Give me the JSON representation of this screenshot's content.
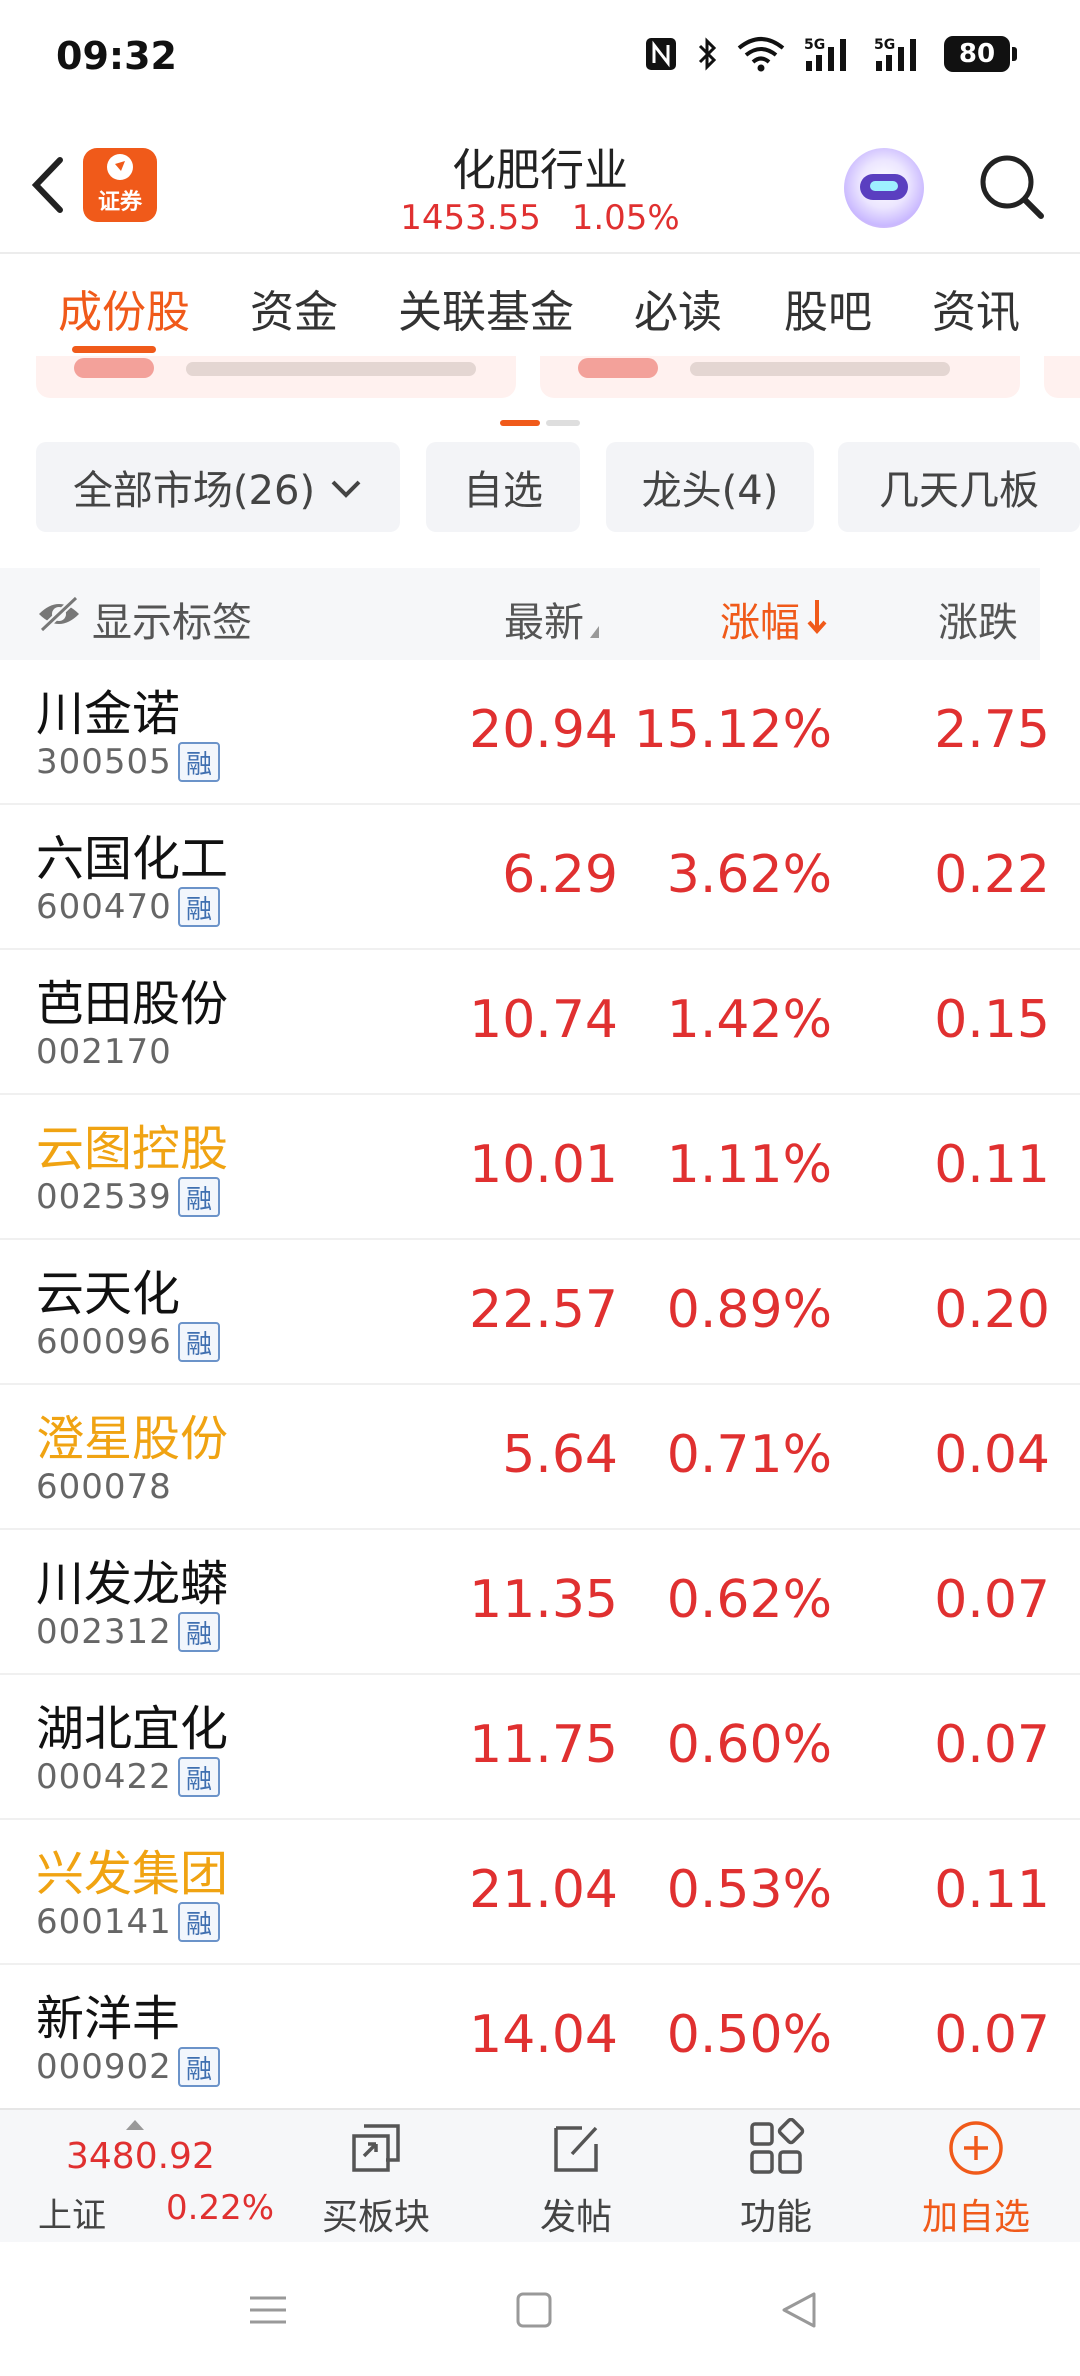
{
  "status_bar": {
    "time": "09:32",
    "battery": "80",
    "icons": [
      "nfc-icon",
      "bluetooth-icon",
      "wifi-icon",
      "signal-5g-icon",
      "signal-5g-icon"
    ]
  },
  "header": {
    "title": "化肥行业",
    "price": "1453.55",
    "change_pct": "1.05%",
    "logo_text": "证券"
  },
  "tabs": [
    {
      "label": "成份股",
      "active": true
    },
    {
      "label": "资金"
    },
    {
      "label": "关联基金"
    },
    {
      "label": "必读"
    },
    {
      "label": "股吧"
    },
    {
      "label": "资讯"
    }
  ],
  "filters": {
    "market": "全部市场(26)",
    "watchlist": "自选",
    "leaders": "龙头(4)",
    "streak": "几天几板"
  },
  "table": {
    "col_label": "显示标签",
    "col_latest": "最新",
    "col_change_pct": "涨幅",
    "col_change": "涨跌",
    "rows": [
      {
        "name": "川金诺",
        "code": "300505",
        "margin": true,
        "highlight": false,
        "latest": "20.94",
        "pct": "15.12%",
        "chg": "2.75"
      },
      {
        "name": "六国化工",
        "code": "600470",
        "margin": true,
        "highlight": false,
        "latest": "6.29",
        "pct": "3.62%",
        "chg": "0.22"
      },
      {
        "name": "芭田股份",
        "code": "002170",
        "margin": false,
        "highlight": false,
        "latest": "10.74",
        "pct": "1.42%",
        "chg": "0.15"
      },
      {
        "name": "云图控股",
        "code": "002539",
        "margin": true,
        "highlight": true,
        "latest": "10.01",
        "pct": "1.11%",
        "chg": "0.11"
      },
      {
        "name": "云天化",
        "code": "600096",
        "margin": true,
        "highlight": false,
        "latest": "22.57",
        "pct": "0.89%",
        "chg": "0.20"
      },
      {
        "name": "澄星股份",
        "code": "600078",
        "margin": false,
        "highlight": true,
        "latest": "5.64",
        "pct": "0.71%",
        "chg": "0.04"
      },
      {
        "name": "川发龙蟒",
        "code": "002312",
        "margin": true,
        "highlight": false,
        "latest": "11.35",
        "pct": "0.62%",
        "chg": "0.07"
      },
      {
        "name": "湖北宜化",
        "code": "000422",
        "margin": true,
        "highlight": false,
        "latest": "11.75",
        "pct": "0.60%",
        "chg": "0.07"
      },
      {
        "name": "兴发集团",
        "code": "600141",
        "margin": true,
        "highlight": true,
        "latest": "21.04",
        "pct": "0.53%",
        "chg": "0.11"
      },
      {
        "name": "新洋丰",
        "code": "000902",
        "margin": true,
        "highlight": false,
        "latest": "14.04",
        "pct": "0.50%",
        "chg": "0.07"
      }
    ],
    "margin_badge": "融"
  },
  "bottom_bar": {
    "index_value": "3480.92",
    "index_name": "上证",
    "index_change": "0.22%",
    "buy_sector": "买板块",
    "post": "发帖",
    "functions": "功能",
    "add_watch": "加自选"
  },
  "colors": {
    "accent": "#f05a1a",
    "up": "#e03030",
    "highlight_name": "#f0a312"
  }
}
